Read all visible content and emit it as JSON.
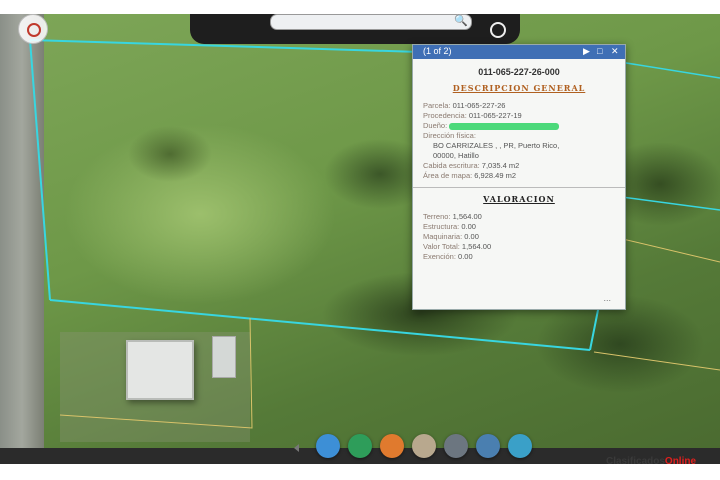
{
  "map": {
    "search_placeholder": ""
  },
  "popup": {
    "counter": "(1 of 2)",
    "parcel_id": "011-065-227-26-000",
    "sections": {
      "general_title": "DESCRIPCION GENERAL",
      "valuation_title": "VALORACION"
    },
    "general_rows": [
      {
        "label": "Parcela:",
        "value": "011-065-227-26"
      },
      {
        "label": "Procedencia:",
        "value": "011-065-227-19"
      },
      {
        "label": "Dueño:",
        "value": ""
      },
      {
        "label": "Dirección física:",
        "value": ""
      }
    ],
    "address_lines": [
      "BO CARRIZALES , , PR, Puerto Rico,",
      "00000, Hatillo"
    ],
    "area_rows": [
      {
        "label": "Cabida escritura:",
        "value": "7,035.4 m2"
      },
      {
        "label": "Área de mapa:",
        "value": "6,928.49 m2"
      }
    ],
    "valuation_rows": [
      {
        "label": "Terreno:",
        "value": "1,564.00"
      },
      {
        "label": "Estructura:",
        "value": "0.00"
      },
      {
        "label": "Maquinaria:",
        "value": "0.00"
      },
      {
        "label": "Valor Total:",
        "value": "1,564.00"
      },
      {
        "label": "Exención:",
        "value": "0.00"
      }
    ],
    "more": "..."
  },
  "toolbar": {
    "colors": [
      "#3d8fd6",
      "#2e9d5a",
      "#e07a2e",
      "#b8a88e",
      "#6c7680",
      "#4a7fb0",
      "#3aa0c8"
    ],
    "icons": [
      "globe-icon",
      "flag-icon",
      "basemap-icon",
      "layers-icon",
      "list-icon",
      "folder-icon",
      "cart-icon"
    ]
  },
  "watermark": {
    "prefix": "Clasificados",
    "suffix": "Online"
  }
}
